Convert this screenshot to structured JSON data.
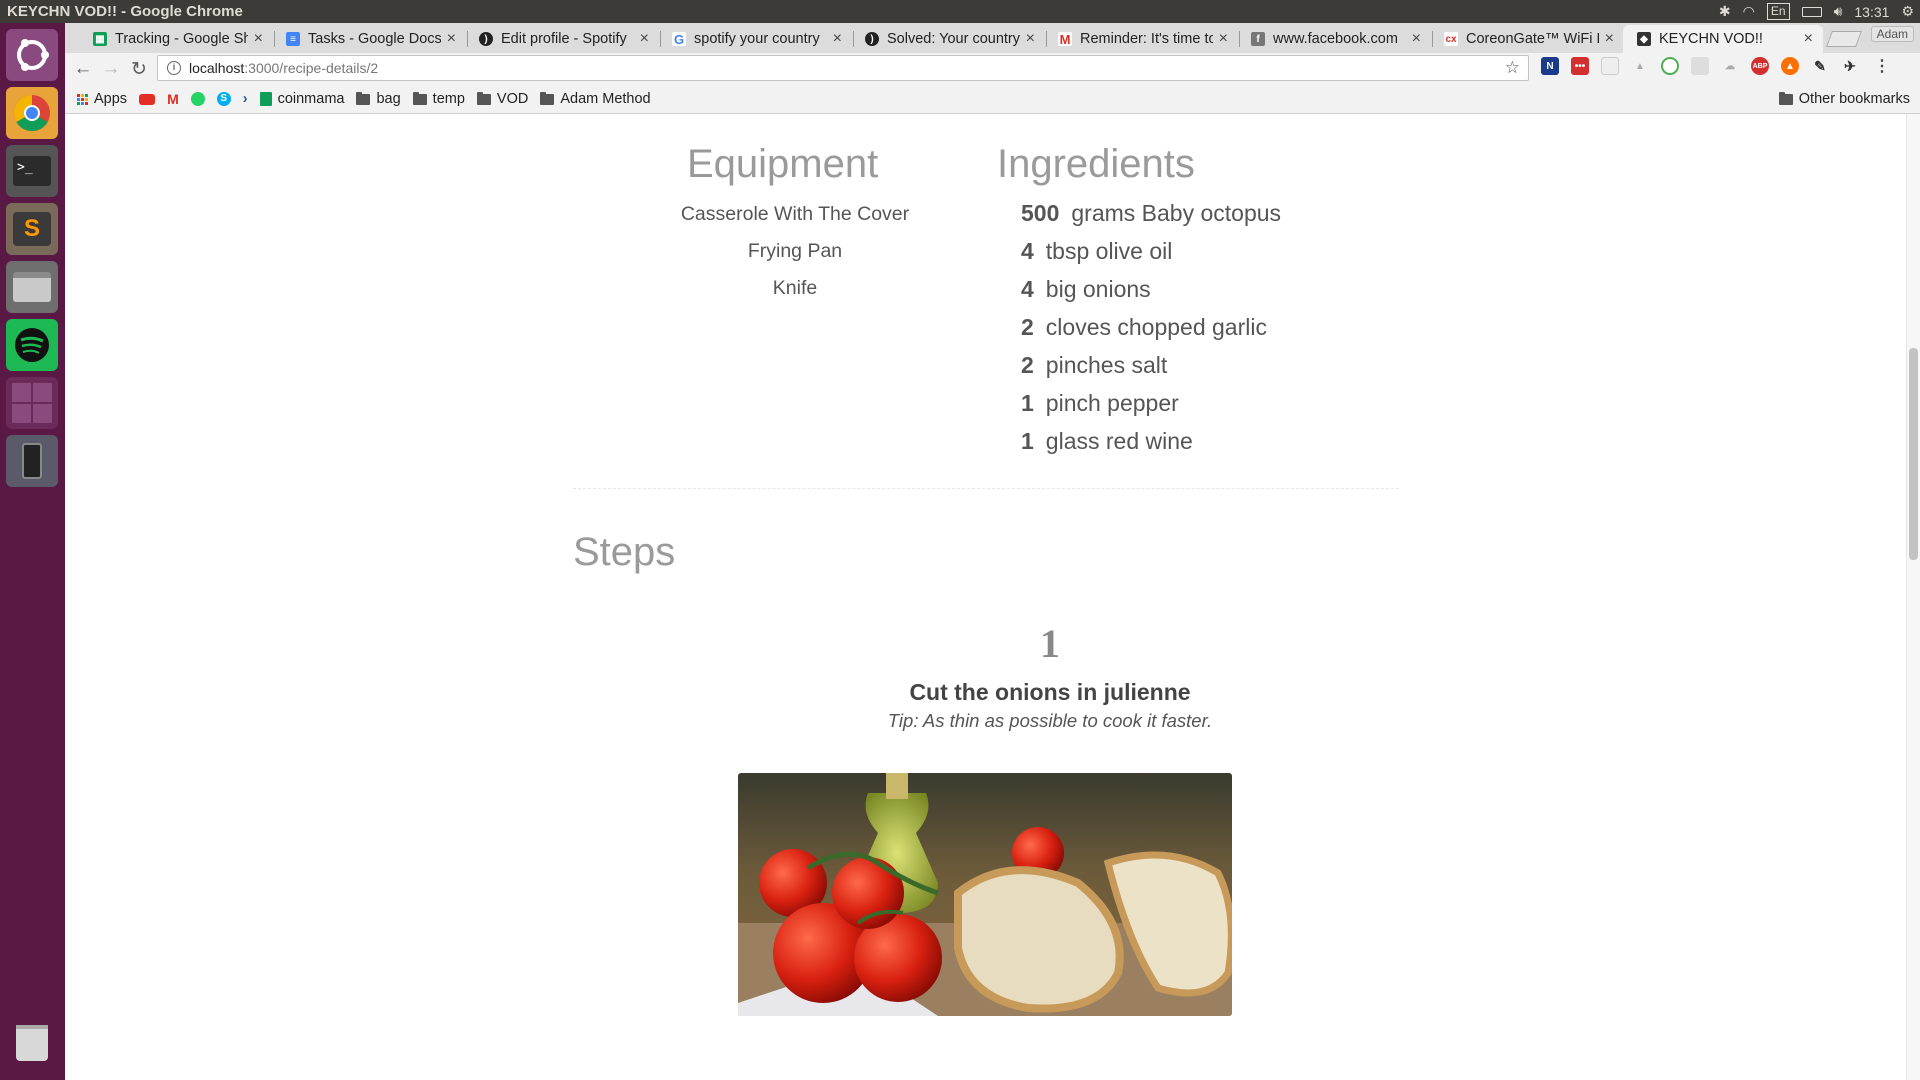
{
  "os": {
    "window_title": "KEYCHN VOD!! - Google Chrome",
    "language_indicator": "En",
    "clock": "13:31",
    "launcher_icons": [
      "ubuntu-dash-icon",
      "chrome-icon",
      "terminal-icon",
      "sublime-text-icon",
      "files-icon",
      "spotify-icon",
      "workspaces-icon",
      "phone-icon",
      "trash-icon"
    ]
  },
  "browser": {
    "profile": "Adam",
    "tabs": [
      {
        "label": "Tracking - Google Sheets",
        "favicon": "sheets-icon",
        "color": "#0f9d58"
      },
      {
        "label": "Tasks - Google Docs",
        "favicon": "docs-icon",
        "color": "#4285f4"
      },
      {
        "label": "Edit profile - Spotify",
        "favicon": "spotify-icon",
        "color": "#222222"
      },
      {
        "label": "spotify your country",
        "favicon": "google-icon",
        "color": "#4285f4"
      },
      {
        "label": "Solved: Your country",
        "favicon": "spotify-icon",
        "color": "#222222"
      },
      {
        "label": "Reminder: It's time to",
        "favicon": "gmail-icon",
        "color": "#d93025"
      },
      {
        "label": "www.facebook.com",
        "favicon": "facebook-icon",
        "color": "#777777"
      },
      {
        "label": "CoreonGate™ WiFi L",
        "favicon": "coreongate-icon",
        "color": "#d93025"
      },
      {
        "label": "KEYCHN VOD!!",
        "favicon": "keychn-icon",
        "color": "#333333",
        "active": true
      }
    ],
    "url_host": "localhost",
    "url_rest": ":3000/recipe-details/2",
    "bookmarks": [
      {
        "label": "Apps",
        "icon": "apps-grid-icon"
      },
      {
        "label": "",
        "icon": "youtube-icon"
      },
      {
        "label": "",
        "icon": "gmail-icon"
      },
      {
        "label": "",
        "icon": "whatsapp-icon"
      },
      {
        "label": "",
        "icon": "skype-icon"
      },
      {
        "label": "",
        "icon": "arrow-icon"
      },
      {
        "label": "coinmama",
        "icon": "sheets-icon"
      },
      {
        "label": "bag",
        "icon": "folder-icon"
      },
      {
        "label": "temp",
        "icon": "folder-icon"
      },
      {
        "label": "VOD",
        "icon": "folder-icon"
      },
      {
        "label": "Adam Method",
        "icon": "folder-icon"
      }
    ],
    "other_bookmarks": "Other bookmarks"
  },
  "recipe": {
    "equipment_heading": "Equipment",
    "equipment": [
      "Casserole With The Cover",
      "Frying Pan",
      "Knife"
    ],
    "ingredients_heading": "Ingredients",
    "ingredients": [
      {
        "qty": "500",
        "text": "grams Baby octopus"
      },
      {
        "qty": "4",
        "text": "tbsp olive oil"
      },
      {
        "qty": "4",
        "text": "big onions"
      },
      {
        "qty": "2",
        "text": "cloves chopped garlic"
      },
      {
        "qty": "2",
        "text": "pinches salt"
      },
      {
        "qty": "1",
        "text": "pinch pepper"
      },
      {
        "qty": "1",
        "text": "glass red wine"
      }
    ],
    "steps_heading": "Steps",
    "steps": [
      {
        "number": "1",
        "title": "Cut the onions in julienne",
        "tip": "Tip: As thin as possible to cook it faster.",
        "image": "tomatoes-bread-olive-oil-photo"
      }
    ]
  }
}
